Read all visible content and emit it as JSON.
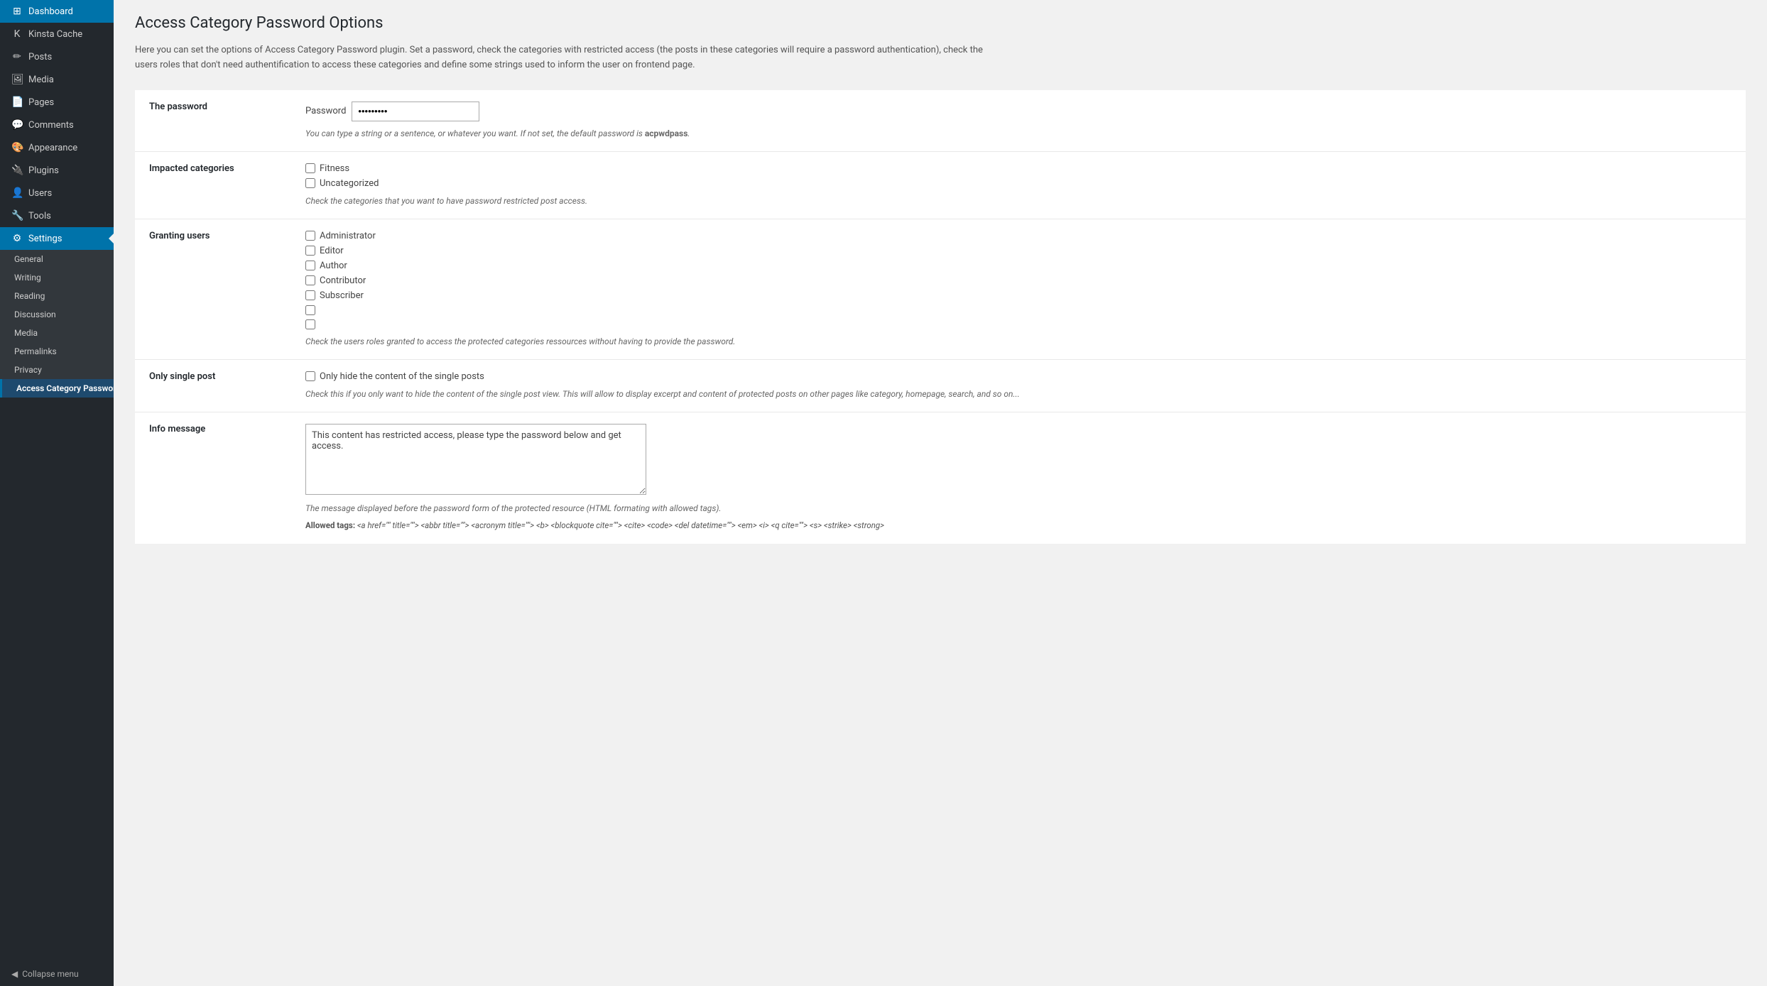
{
  "sidebar": {
    "logo": {
      "label": "Dashboard",
      "icon": "⊞"
    },
    "kinsta": {
      "label": "Kinsta Cache",
      "icon": "K"
    },
    "items": [
      {
        "label": "Posts",
        "icon": "✏",
        "name": "posts"
      },
      {
        "label": "Media",
        "icon": "🖼",
        "name": "media"
      },
      {
        "label": "Pages",
        "icon": "📄",
        "name": "pages"
      },
      {
        "label": "Comments",
        "icon": "💬",
        "name": "comments"
      },
      {
        "label": "Appearance",
        "icon": "🎨",
        "name": "appearance"
      },
      {
        "label": "Plugins",
        "icon": "🔌",
        "name": "plugins"
      },
      {
        "label": "Users",
        "icon": "👤",
        "name": "users"
      },
      {
        "label": "Tools",
        "icon": "🔧",
        "name": "tools"
      },
      {
        "label": "Settings",
        "icon": "⚙",
        "name": "settings",
        "active": true
      }
    ],
    "settings_submenu": [
      {
        "label": "General",
        "name": "general"
      },
      {
        "label": "Writing",
        "name": "writing"
      },
      {
        "label": "Reading",
        "name": "reading"
      },
      {
        "label": "Discussion",
        "name": "discussion"
      },
      {
        "label": "Media",
        "name": "media-settings"
      },
      {
        "label": "Permalinks",
        "name": "permalinks"
      },
      {
        "label": "Privacy",
        "name": "privacy"
      },
      {
        "label": "Access Category Password",
        "name": "access-category-password",
        "active": true
      }
    ],
    "collapse_label": "Collapse menu"
  },
  "page": {
    "title": "Access Category Password Options",
    "description": "Here you can set the options of Access Category Password plugin. Set a password, check the categories with restricted access (the posts in these categories will require a password authentication), check the users roles that don't need authentification to access these categories and define some strings used to inform the user on frontend page.",
    "sections": {
      "password": {
        "label": "The password",
        "field_label": "Password",
        "field_value": "•••••••••",
        "hint": "You can type a string or a sentence, or whatever you want. If not set, the default password is acpwdpass."
      },
      "categories": {
        "label": "Impacted categories",
        "options": [
          "Fitness",
          "Uncategorized"
        ],
        "hint": "Check the categories that you want to have password restricted post access."
      },
      "granting_users": {
        "label": "Granting users",
        "roles": [
          "Administrator",
          "Editor",
          "Author",
          "Contributor",
          "Subscriber",
          "",
          ""
        ],
        "hint": "Check the users roles granted to access the protected categories ressources without having to provide the password."
      },
      "single_post": {
        "label": "Only single post",
        "checkbox_label": "Only hide the content of the single posts",
        "hint": "Check this if you only want to hide the content of the single post view. This will allow to display excerpt and content of protected posts on other pages like category, homepage, search, and so on..."
      },
      "info_message": {
        "label": "Info message",
        "value": "This content has restricted access, please type the password below and get access.",
        "hint": "The message displayed before the password form of the protected resource (HTML formating with allowed tags).",
        "allowed_tags_label": "Allowed tags:",
        "allowed_tags": "<a href=\"\" title=\"\"> <abbr title=\"\"> <acronym title=\"\"> <b> <blockquote cite=\"\"> <cite> <code> <del datetime=\"\"> <em> <i> <q cite=\"\"> <s> <strike> <strong>"
      }
    }
  }
}
